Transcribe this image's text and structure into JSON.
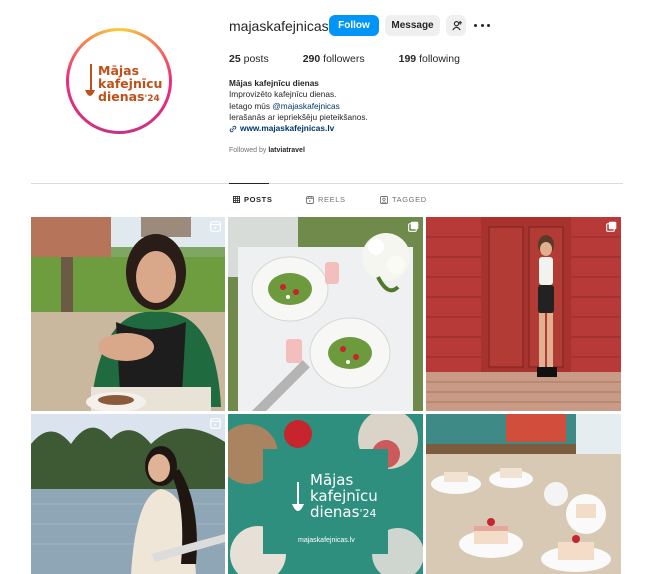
{
  "profile": {
    "username": "majaskafejnicas",
    "logo_line1": "Mājas",
    "logo_line2": "kafejnīcu",
    "logo_line3": "dienas",
    "logo_year": "'24"
  },
  "actions": {
    "follow_label": "Follow",
    "message_label": "Message"
  },
  "stats": {
    "posts_count": "25",
    "posts_label": "posts",
    "followers_count": "290",
    "followers_label": "followers",
    "following_count": "199",
    "following_label": "following"
  },
  "bio": {
    "name": "Mājas kafejnīcu dienas",
    "line1": "Improvizēto kafejnīcu dienas.",
    "line2_prefix": "Ietago mūs",
    "mention": "@majaskafejnicas",
    "line3": "Ierašanās ar iepriekšēju pieteikšanos.",
    "link": "www.majaskafejnicas.lv",
    "followed_by_prefix": "Followed by",
    "followed_by_user": "latviatravel"
  },
  "tabs": [
    {
      "label": "POSTS",
      "icon": "grid-icon",
      "active": true
    },
    {
      "label": "REELS",
      "icon": "reels-icon",
      "active": false
    },
    {
      "label": "TAGGED",
      "icon": "tagged-icon",
      "active": false
    }
  ],
  "posts": [
    {
      "type": "reel",
      "subject": "woman-eating-outdoors"
    },
    {
      "type": "multi",
      "subject": "salad-table-flowers"
    },
    {
      "type": "multi",
      "subject": "woman-red-wooden-door"
    },
    {
      "type": "reel",
      "subject": "woman-by-lake"
    },
    {
      "type": "single",
      "subject": "event-logo-poster",
      "poster_title1": "Mājas",
      "poster_title2": "kafejnīcu",
      "poster_title3": "dienas",
      "poster_year": "'24",
      "poster_url": "majaskafejnicas.lv"
    },
    {
      "type": "single",
      "subject": "cakes-buffet-table"
    }
  ],
  "colors": {
    "follow_blue": "#0095f6",
    "link_blue": "#00376b",
    "logo_orange": "#c0501a",
    "poster_teal": "#2f8f7f"
  }
}
